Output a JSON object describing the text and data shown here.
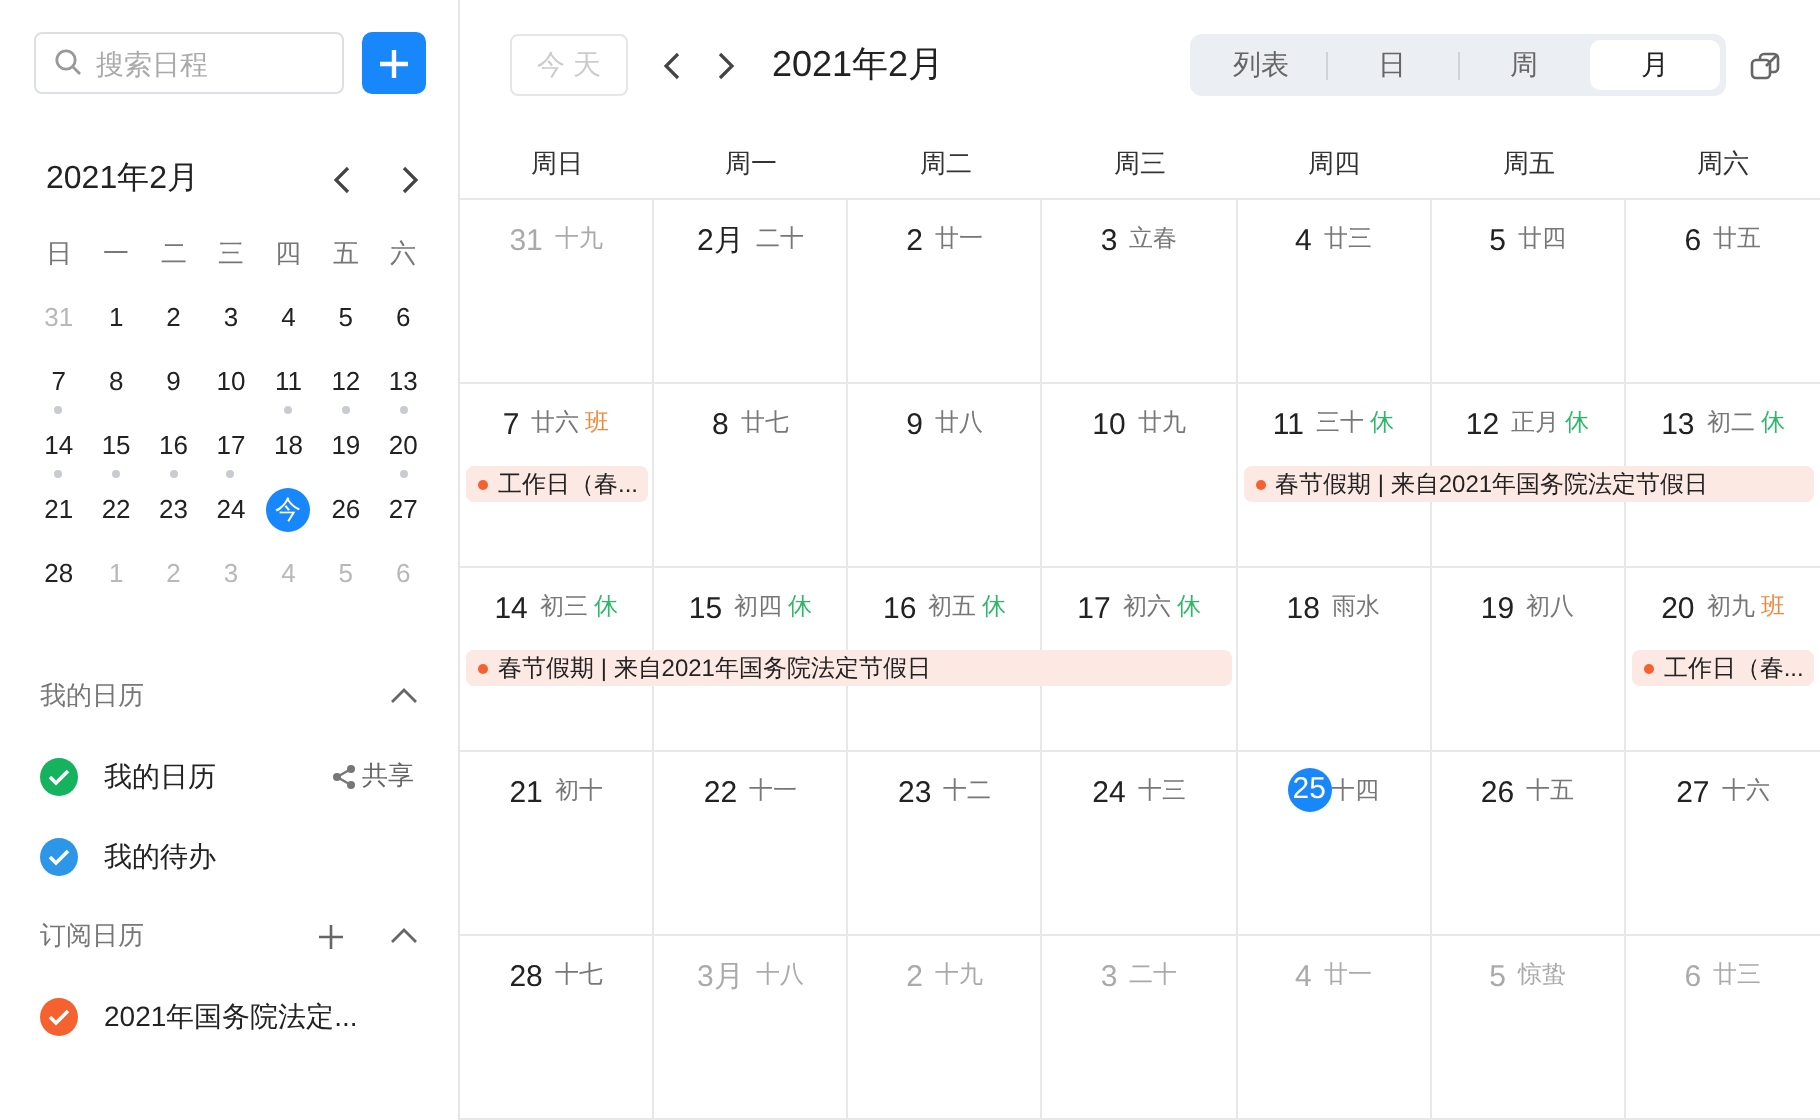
{
  "sidebar": {
    "search": {
      "placeholder": "搜索日程"
    },
    "mini_calendar": {
      "title": "2021年2月",
      "weekdays": [
        "日",
        "一",
        "二",
        "三",
        "四",
        "五",
        "六"
      ],
      "weeks": [
        {
          "days": [
            {
              "day": "31",
              "outside": true,
              "dot": false,
              "today": false
            },
            {
              "day": "1",
              "outside": false,
              "dot": false,
              "today": false
            },
            {
              "day": "2",
              "outside": false,
              "dot": false,
              "today": false
            },
            {
              "day": "3",
              "outside": false,
              "dot": false,
              "today": false
            },
            {
              "day": "4",
              "outside": false,
              "dot": false,
              "today": false
            },
            {
              "day": "5",
              "outside": false,
              "dot": false,
              "today": false
            },
            {
              "day": "6",
              "outside": false,
              "dot": false,
              "today": false
            }
          ]
        },
        {
          "days": [
            {
              "day": "7",
              "outside": false,
              "dot": true,
              "today": false
            },
            {
              "day": "8",
              "outside": false,
              "dot": false,
              "today": false
            },
            {
              "day": "9",
              "outside": false,
              "dot": false,
              "today": false
            },
            {
              "day": "10",
              "outside": false,
              "dot": false,
              "today": false
            },
            {
              "day": "11",
              "outside": false,
              "dot": true,
              "today": false
            },
            {
              "day": "12",
              "outside": false,
              "dot": true,
              "today": false
            },
            {
              "day": "13",
              "outside": false,
              "dot": true,
              "today": false
            }
          ]
        },
        {
          "days": [
            {
              "day": "14",
              "outside": false,
              "dot": true,
              "today": false
            },
            {
              "day": "15",
              "outside": false,
              "dot": true,
              "today": false
            },
            {
              "day": "16",
              "outside": false,
              "dot": true,
              "today": false
            },
            {
              "day": "17",
              "outside": false,
              "dot": true,
              "today": false
            },
            {
              "day": "18",
              "outside": false,
              "dot": false,
              "today": false
            },
            {
              "day": "19",
              "outside": false,
              "dot": false,
              "today": false
            },
            {
              "day": "20",
              "outside": false,
              "dot": true,
              "today": false
            }
          ]
        },
        {
          "days": [
            {
              "day": "21",
              "outside": false,
              "dot": false,
              "today": false
            },
            {
              "day": "22",
              "outside": false,
              "dot": false,
              "today": false
            },
            {
              "day": "23",
              "outside": false,
              "dot": false,
              "today": false
            },
            {
              "day": "24",
              "outside": false,
              "dot": false,
              "today": false
            },
            {
              "day": "今",
              "outside": false,
              "dot": false,
              "today": true
            },
            {
              "day": "26",
              "outside": false,
              "dot": false,
              "today": false
            },
            {
              "day": "27",
              "outside": false,
              "dot": false,
              "today": false
            }
          ]
        },
        {
          "days": [
            {
              "day": "28",
              "outside": false,
              "dot": false,
              "today": false
            },
            {
              "day": "1",
              "outside": true,
              "dot": false,
              "today": false
            },
            {
              "day": "2",
              "outside": true,
              "dot": false,
              "today": false
            },
            {
              "day": "3",
              "outside": true,
              "dot": false,
              "today": false
            },
            {
              "day": "4",
              "outside": true,
              "dot": false,
              "today": false
            },
            {
              "day": "5",
              "outside": true,
              "dot": false,
              "today": false
            },
            {
              "day": "6",
              "outside": true,
              "dot": false,
              "today": false
            }
          ]
        }
      ]
    },
    "sections": [
      {
        "title": "我的日历",
        "expanded": true,
        "addable": false,
        "calendars": [
          {
            "name": "我的日历",
            "color": "#16b35e",
            "checked": true,
            "share": "共享"
          },
          {
            "name": "我的待办",
            "color": "#2d96e8",
            "checked": true
          }
        ]
      },
      {
        "title": "订阅日历",
        "expanded": true,
        "addable": true,
        "calendars": [
          {
            "name": "2021年国务院法定...",
            "color": "#f5612f",
            "checked": true
          }
        ]
      }
    ]
  },
  "toolbar": {
    "today": {
      "label": "今 天",
      "disabled": true
    },
    "title": "2021年2月",
    "views": [
      {
        "label": "列表",
        "selected": false
      },
      {
        "label": "日",
        "selected": false
      },
      {
        "label": "周",
        "selected": false
      },
      {
        "label": "月",
        "selected": true
      }
    ]
  },
  "month": {
    "weekdays": [
      "周日",
      "周一",
      "周二",
      "周三",
      "周四",
      "周五",
      "周六"
    ],
    "weeks": [
      {
        "days": [
          {
            "day": "31",
            "lunar": "十九",
            "outside": true,
            "today": false
          },
          {
            "day": "2月",
            "lunar": "二十",
            "outside": false,
            "today": false
          },
          {
            "day": "2",
            "lunar": "廿一",
            "outside": false,
            "today": false
          },
          {
            "day": "3",
            "lunar": "立春",
            "outside": false,
            "today": false
          },
          {
            "day": "4",
            "lunar": "廿三",
            "outside": false,
            "today": false
          },
          {
            "day": "5",
            "lunar": "廿四",
            "outside": false,
            "today": false
          },
          {
            "day": "6",
            "lunar": "廿五",
            "outside": false,
            "today": false
          }
        ]
      },
      {
        "days": [
          {
            "day": "7",
            "lunar": "廿六",
            "badge": {
              "text": "班",
              "kind": "work"
            },
            "outside": false,
            "today": false,
            "event": {
              "text": "工作日（春..."
            }
          },
          {
            "day": "8",
            "lunar": "廿七",
            "outside": false,
            "today": false
          },
          {
            "day": "9",
            "lunar": "廿八",
            "outside": false,
            "today": false
          },
          {
            "day": "10",
            "lunar": "廿九",
            "outside": false,
            "today": false
          },
          {
            "day": "11",
            "lunar": "三十",
            "badge": {
              "text": "休",
              "kind": "rest"
            },
            "outside": false,
            "today": false,
            "event": {
              "text": "春节假期 | 来自2021年国务院法定节假日"
            }
          },
          {
            "day": "12",
            "lunar": "正月",
            "badge": {
              "text": "休",
              "kind": "rest"
            },
            "outside": false,
            "today": false,
            "continues_event": true
          },
          {
            "day": "13",
            "lunar": "初二",
            "badge": {
              "text": "休",
              "kind": "rest"
            },
            "outside": false,
            "today": false,
            "continues_event": true
          }
        ]
      },
      {
        "days": [
          {
            "day": "14",
            "lunar": "初三",
            "badge": {
              "text": "休",
              "kind": "rest"
            },
            "outside": false,
            "today": false,
            "event": {
              "text": "春节假期 | 来自2021年国务院法定节假日"
            }
          },
          {
            "day": "15",
            "lunar": "初四",
            "badge": {
              "text": "休",
              "kind": "rest"
            },
            "outside": false,
            "today": false,
            "continues_event": true
          },
          {
            "day": "16",
            "lunar": "初五",
            "badge": {
              "text": "休",
              "kind": "rest"
            },
            "outside": false,
            "today": false,
            "continues_event": true
          },
          {
            "day": "17",
            "lunar": "初六",
            "badge": {
              "text": "休",
              "kind": "rest"
            },
            "outside": false,
            "today": false,
            "continues_event": true
          },
          {
            "day": "18",
            "lunar": "雨水",
            "outside": false,
            "today": false
          },
          {
            "day": "19",
            "lunar": "初八",
            "outside": false,
            "today": false
          },
          {
            "day": "20",
            "lunar": "初九",
            "badge": {
              "text": "班",
              "kind": "work"
            },
            "outside": false,
            "today": false,
            "event": {
              "text": "工作日（春..."
            }
          }
        ]
      },
      {
        "days": [
          {
            "day": "21",
            "lunar": "初十",
            "outside": false,
            "today": false
          },
          {
            "day": "22",
            "lunar": "十一",
            "outside": false,
            "today": false
          },
          {
            "day": "23",
            "lunar": "十二",
            "outside": false,
            "today": false
          },
          {
            "day": "24",
            "lunar": "十三",
            "outside": false,
            "today": false
          },
          {
            "day": "25",
            "lunar": "十四",
            "outside": false,
            "today": true
          },
          {
            "day": "26",
            "lunar": "十五",
            "outside": false,
            "today": false
          },
          {
            "day": "27",
            "lunar": "十六",
            "outside": false,
            "today": false
          }
        ]
      },
      {
        "days": [
          {
            "day": "28",
            "lunar": "十七",
            "outside": false,
            "today": false
          },
          {
            "day": "3月",
            "lunar": "十八",
            "outside": true,
            "today": false
          },
          {
            "day": "2",
            "lunar": "十九",
            "outside": true,
            "today": false
          },
          {
            "day": "3",
            "lunar": "二十",
            "outside": true,
            "today": false
          },
          {
            "day": "4",
            "lunar": "廿一",
            "outside": true,
            "today": false
          },
          {
            "day": "5",
            "lunar": "惊蛰",
            "outside": true,
            "today": false
          },
          {
            "day": "6",
            "lunar": "廿三",
            "outside": true,
            "today": false
          }
        ]
      }
    ]
  }
}
